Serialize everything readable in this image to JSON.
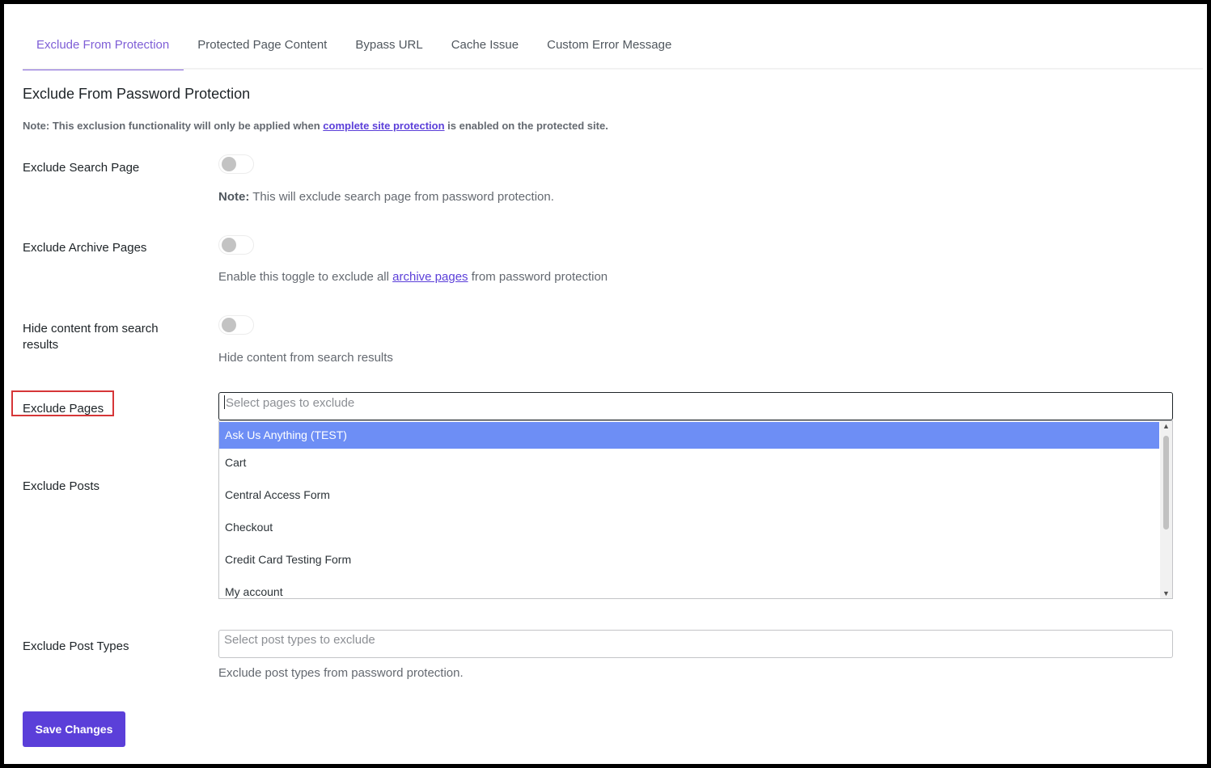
{
  "tabs": [
    {
      "label": "Exclude From Protection",
      "active": true
    },
    {
      "label": "Protected Page Content",
      "active": false
    },
    {
      "label": "Bypass URL",
      "active": false
    },
    {
      "label": "Cache Issue",
      "active": false
    },
    {
      "label": "Custom Error Message",
      "active": false
    }
  ],
  "section": {
    "title": "Exclude From Password Protection",
    "note_prefix": "Note: This exclusion functionality will only be applied when",
    "note_link": "complete site protection",
    "note_suffix": "is enabled on the protected site."
  },
  "settings": {
    "search_page": {
      "label": "Exclude Search Page",
      "enabled": false,
      "note_strong": "Note:",
      "note_text": "This will exclude search page from password protection."
    },
    "archive_pages": {
      "label": "Exclude Archive Pages",
      "enabled": false,
      "desc_prefix": "Enable this toggle to exclude all",
      "desc_link": "archive pages",
      "desc_suffix": "from password protection"
    },
    "hide_search": {
      "label": "Hide content from search results",
      "enabled": false,
      "desc": "Hide content from search results"
    },
    "exclude_pages": {
      "label": "Exclude Pages",
      "placeholder": "Select pages to exclude",
      "options": [
        "Ask Us Anything (TEST)",
        "Cart",
        "Central Access Form",
        "Checkout",
        "Credit Card Testing Form",
        "My account"
      ],
      "highlighted": "Ask Us Anything (TEST)"
    },
    "exclude_posts": {
      "label": "Exclude Posts"
    },
    "exclude_post_types": {
      "label": "Exclude Post Types",
      "placeholder": "Select post types to exclude",
      "desc": "Exclude post types from password protection."
    }
  },
  "save_label": "Save Changes",
  "colors": {
    "accent": "#5b3fd9",
    "tab_active": "#7e5ed6",
    "highlight": "#6d8ef5",
    "annotation_box": "#d63638"
  },
  "icons": {
    "scroll_up": "▲",
    "scroll_down": "▼"
  }
}
